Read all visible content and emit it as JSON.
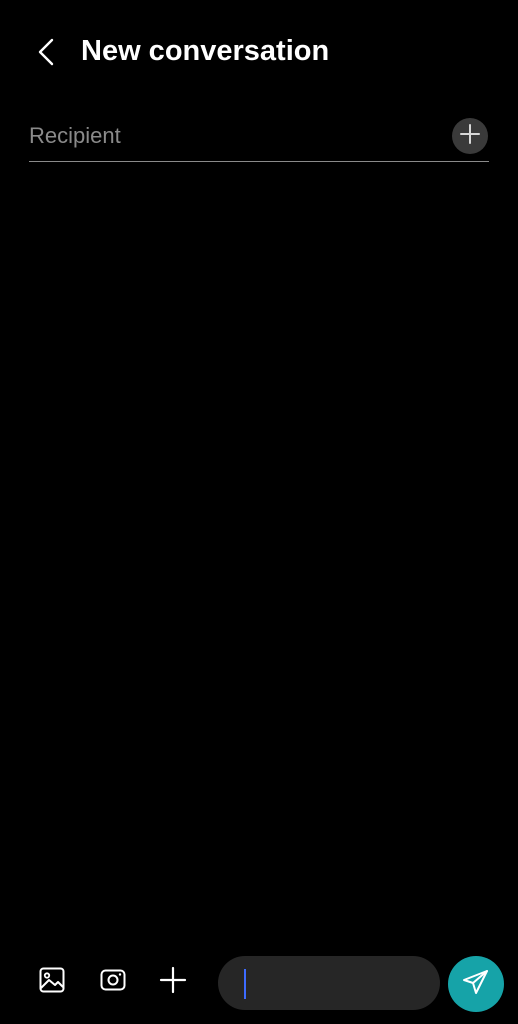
{
  "header": {
    "title": "New conversation",
    "back_icon": "chevron-left-icon"
  },
  "recipient": {
    "placeholder": "Recipient",
    "value": "",
    "add_icon": "plus-icon"
  },
  "composer": {
    "tools": [
      {
        "icon": "image-icon"
      },
      {
        "icon": "camera-icon"
      },
      {
        "icon": "plus-icon"
      }
    ],
    "message_placeholder": "",
    "message_value": "",
    "send_icon": "send-icon"
  },
  "colors": {
    "background": "#000000",
    "text": "#ffffff",
    "placeholder": "#8a8a8a",
    "field_bg": "#262626",
    "cursor": "#3d6bff",
    "send_bg": "#16a3a8",
    "add_btn_bg": "#3a3a3a"
  }
}
